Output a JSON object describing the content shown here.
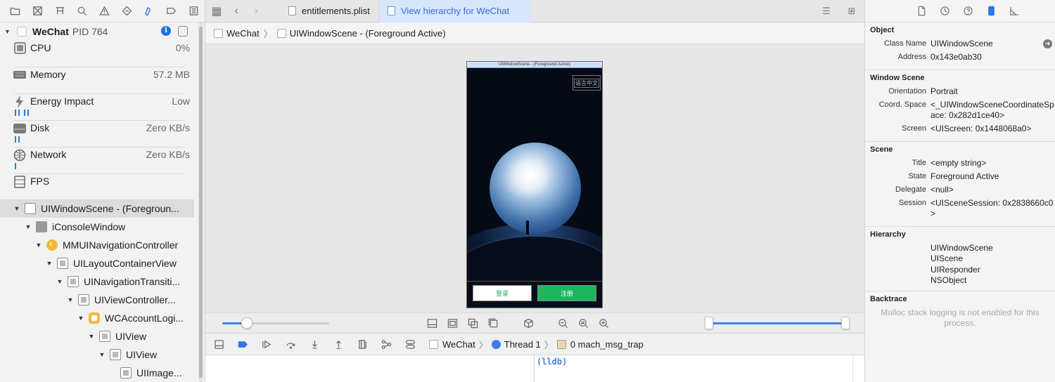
{
  "process": {
    "name": "WeChat",
    "pid": "PID 764"
  },
  "gauges": [
    {
      "label": "CPU",
      "value": "0%",
      "icon": "cpu-icon"
    },
    {
      "label": "Memory",
      "value": "57.2 MB",
      "icon": "memory-icon"
    },
    {
      "label": "Energy Impact",
      "value": "Low",
      "icon": "energy-icon"
    },
    {
      "label": "Disk",
      "value": "Zero KB/s",
      "icon": "disk-icon"
    },
    {
      "label": "Network",
      "value": "Zero KB/s",
      "icon": "network-icon"
    },
    {
      "label": "FPS",
      "value": "",
      "icon": "fps-icon"
    }
  ],
  "tree": [
    {
      "label": "UIWindowScene - (Foregroun...",
      "icon": "scene"
    },
    {
      "label": "iConsoleWindow",
      "icon": "gray"
    },
    {
      "label": "MMUINavigationController",
      "icon": "orange"
    },
    {
      "label": "UILayoutContainerView",
      "icon": "view"
    },
    {
      "label": "UINavigationTransiti...",
      "icon": "view"
    },
    {
      "label": "UIViewController...",
      "icon": "view"
    },
    {
      "label": "WCAccountLogi...",
      "icon": "yellowbox"
    },
    {
      "label": "UIView",
      "icon": "view"
    },
    {
      "label": "UIView",
      "icon": "view"
    },
    {
      "label": "UIImage...",
      "icon": "view"
    }
  ],
  "tabs": {
    "plist": "entitlements.plist",
    "active": "View hierarchy for WeChat"
  },
  "breadcrumb": {
    "app": "WeChat",
    "scene": "UIWindowScene - (Foreground Active)"
  },
  "phone": {
    "header": "UIWindowScene - (Foreground Active)",
    "lang_button": "语言中文",
    "login": "登录",
    "register": "注册"
  },
  "zoom_fraction": 0.23,
  "range": [
    0.0,
    1.0
  ],
  "debug": {
    "app": "WeChat",
    "thread": "Thread 1",
    "frame": "0 mach_msg_trap"
  },
  "console": {
    "prompt": "(lldb)"
  },
  "inspector": {
    "object_title": "Object",
    "class_name_key": "Class Name",
    "class_name": "UIWindowScene",
    "address_key": "Address",
    "address": "0x143e0ab30",
    "window_scene_title": "Window Scene",
    "orientation_key": "Orientation",
    "orientation": "Portrait",
    "coord_key": "Coord. Space",
    "coord": "<_UIWindowSceneCoordinateSpace: 0x282d1ce40>",
    "screen_key": "Screen",
    "screen": "<UIScreen: 0x1448068a0>",
    "scene_title": "Scene",
    "title_key": "Title",
    "title": "<empty string>",
    "state_key": "State",
    "state": "Foreground Active",
    "delegate_key": "Delegate",
    "delegate": "<null>",
    "session_key": "Session",
    "session": "<UISceneSession: 0x2838660c0>",
    "hierarchy_title": "Hierarchy",
    "hierarchy": [
      "UIWindowScene",
      "UIScene",
      "UIResponder",
      "NSObject"
    ],
    "backtrace_title": "Backtrace",
    "backtrace_msg": "Malloc stack logging is not enabled for this process."
  }
}
